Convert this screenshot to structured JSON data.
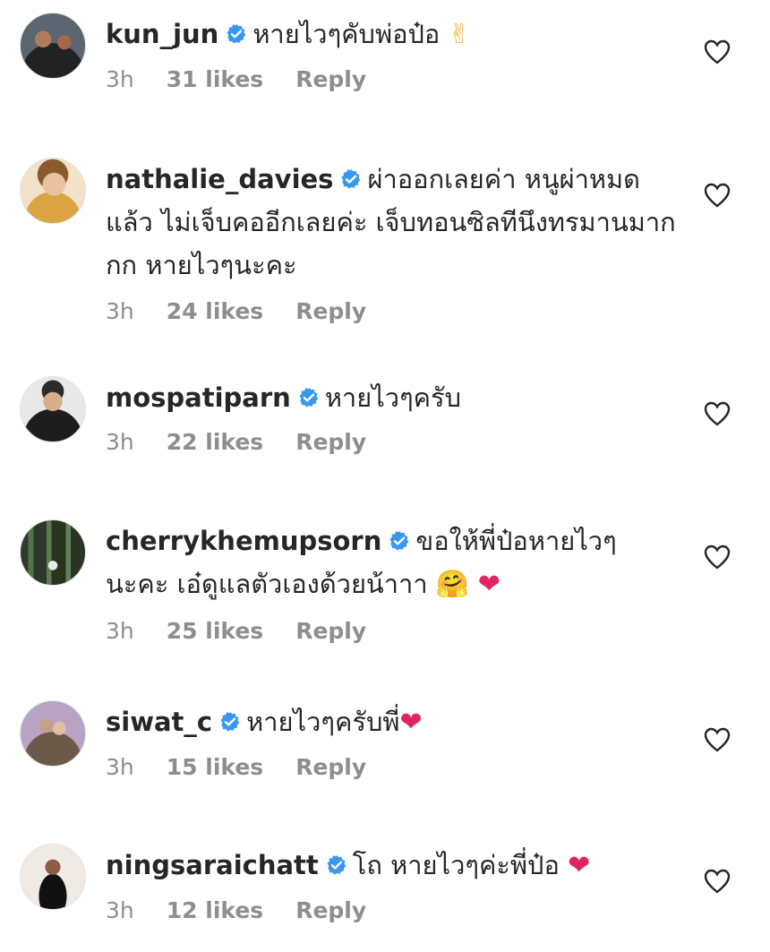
{
  "comments": [
    {
      "username": "kun_jun",
      "text": "หายไวๆคับพ่อป๋อ",
      "emoji": "✌",
      "emoji_color": "#f3b73b",
      "time": "3h",
      "likes": "31 likes",
      "reply": "Reply"
    },
    {
      "username": "nathalie_davies",
      "text": "ผ่าออกเลยค่า หนูผ่าหมดแล้ว ไม่เจ็บคออีกเลยค่ะ  เจ็บทอนซิลทีนึงทรมานมากกก  หายไวๆนะคะ",
      "emoji": "",
      "time": "3h",
      "likes": "24 likes",
      "reply": "Reply"
    },
    {
      "username": "mospatiparn",
      "text": "หายไวๆครับ",
      "emoji": "",
      "time": "3h",
      "likes": "22 likes",
      "reply": "Reply"
    },
    {
      "username": "cherrykhemupsorn",
      "text": "ขอให้พี่ป๋อหายไวๆนะคะ เอ๋ดูแลตัวเองด้วยน้าาา",
      "emoji": "🤗 ❤",
      "emoji_color": "#e0245e",
      "time": "3h",
      "likes": "25 likes",
      "reply": "Reply"
    },
    {
      "username": "siwat_c",
      "text": "หายไวๆครับพี่",
      "emoji": "❤",
      "emoji_color": "#e0245e",
      "time": "3h",
      "likes": "15 likes",
      "reply": "Reply"
    },
    {
      "username": "ningsaraichatt",
      "text": "โถ หายไวๆค่ะพี่ป๋อ",
      "emoji": "❤",
      "emoji_color": "#e0245e",
      "time": "3h",
      "likes": "12 likes",
      "reply": "Reply"
    }
  ],
  "icons": {
    "verified": "verified-badge-icon",
    "like": "heart-outline-icon",
    "verified_color": "#3897f0"
  }
}
